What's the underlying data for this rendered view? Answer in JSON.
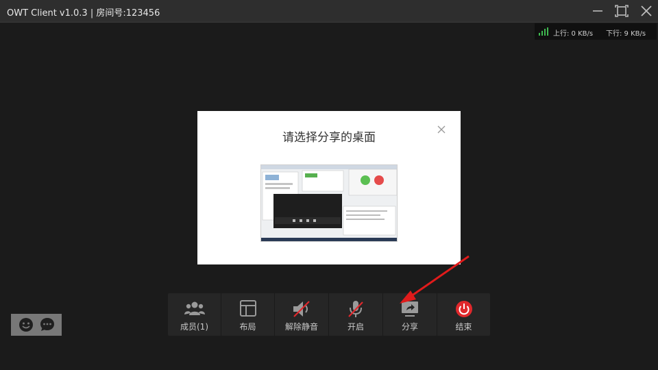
{
  "window": {
    "title": "OWT Client v1.0.3 | 房间号:123456",
    "icons": {
      "minimize": "minimize-icon",
      "maximize": "maximize-icon",
      "close": "close-icon"
    }
  },
  "network": {
    "upload": "上行: 0 KB/s",
    "download": "下行: 9 KB/s",
    "signal_icon": "signal-bars-icon",
    "signal_color": "#3fb950"
  },
  "share_dialog": {
    "title": "请选择分享的桌面",
    "close_icon": "close-icon",
    "thumbnail_icon": "desktop-thumbnail"
  },
  "toolbar": {
    "items": [
      {
        "label": "成员(1)",
        "icon": "members-icon"
      },
      {
        "label": "布局",
        "icon": "layout-icon"
      },
      {
        "label": "解除静音",
        "icon": "speaker-muted-icon"
      },
      {
        "label": "开启",
        "icon": "microphone-off-icon"
      },
      {
        "label": "分享",
        "icon": "screen-share-icon"
      },
      {
        "label": "结束",
        "icon": "power-icon"
      }
    ],
    "accent_red": "#e0282c",
    "icon_gray": "#9a9a9a"
  },
  "chat": {
    "emoji_icon": "emoji-icon",
    "chat_icon": "chat-bubble-icon"
  },
  "annotation": {
    "arrow_color": "#e01b1b"
  }
}
